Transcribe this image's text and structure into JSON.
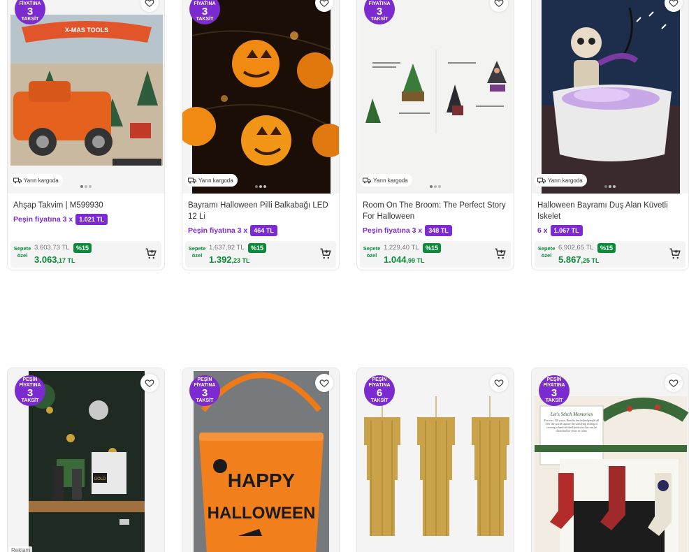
{
  "row1": [
    {
      "title": "Ahşap Takvim | M599930",
      "installment_label": "Peşin fiyatına 3 x",
      "installment_amount": "1.021 TL",
      "old_price": "3.603,73 TL",
      "discount": "%15",
      "new_price_main": "3.063",
      "new_price_cents": ",17 TL",
      "cargo": "Yarın kargoda",
      "badge_top": "PEŞİN FİYATINA",
      "badge_num": "3",
      "badge_bottom": "TAKSİT",
      "img_text": "X-MAS TOOLS"
    },
    {
      "title": "Bayramı Halloween Pilli Balkabağı LED 12 Li",
      "installment_label": "Peşin fiyatına 3 x",
      "installment_amount": "464 TL",
      "old_price": "1.637,92 TL",
      "discount": "%15",
      "new_price_main": "1.392",
      "new_price_cents": ",23 TL",
      "cargo": "Yarın kargoda",
      "badge_top": "PEŞİN FİYATINA",
      "badge_num": "3",
      "badge_bottom": "TAKSİT"
    },
    {
      "title": "Room On The Broom: The Perfect Story For Halloween",
      "installment_label": "Peşin fiyatına 3 x",
      "installment_amount": "348 TL",
      "old_price": "1.229,40 TL",
      "discount": "%15",
      "new_price_main": "1.044",
      "new_price_cents": ",99 TL",
      "cargo": "Yarın kargoda",
      "badge_top": "PEŞİN FİYATINA",
      "badge_num": "3",
      "badge_bottom": "TAKSİT"
    },
    {
      "title": "Halloween Bayramı Duş Alan Küvetli Iskelet",
      "installment_label": "6 x",
      "installment_amount": "1.067 TL",
      "old_price": "6.902,65 TL",
      "discount": "%15",
      "new_price_main": "5.867",
      "new_price_cents": ",25 TL",
      "cargo": "Yarın kargoda"
    }
  ],
  "row2": [
    {
      "badge_top": "PEŞİN FİYATINA",
      "badge_num": "3",
      "badge_bottom": "TAKSİT",
      "reklam": "Reklam",
      "img_text": "GOLD"
    },
    {
      "badge_top": "PEŞİN FİYATINA",
      "badge_num": "3",
      "badge_bottom": "TAKSİT",
      "img_text_1": "HAPPY",
      "img_text_2": "HALLOWEEN"
    },
    {
      "badge_top": "PEŞİN FİYATINA",
      "badge_num": "6",
      "badge_bottom": "TAKSİT"
    },
    {
      "badge_top": "PEŞİN FİYATINA",
      "badge_num": "3",
      "badge_bottom": "TAKSİT",
      "img_text_1": "Let's Stitch Memories",
      "img_text_2": "For over 150 years, Bonifia has helped people all over the world capture the satisfying feeling of creating a hand-stitched heirloom that can be cherished for years to come."
    }
  ],
  "sepete_ozel": "Sepete özel",
  "colors": {
    "purple": "#7b2bd0",
    "green": "#0a8a3a"
  }
}
